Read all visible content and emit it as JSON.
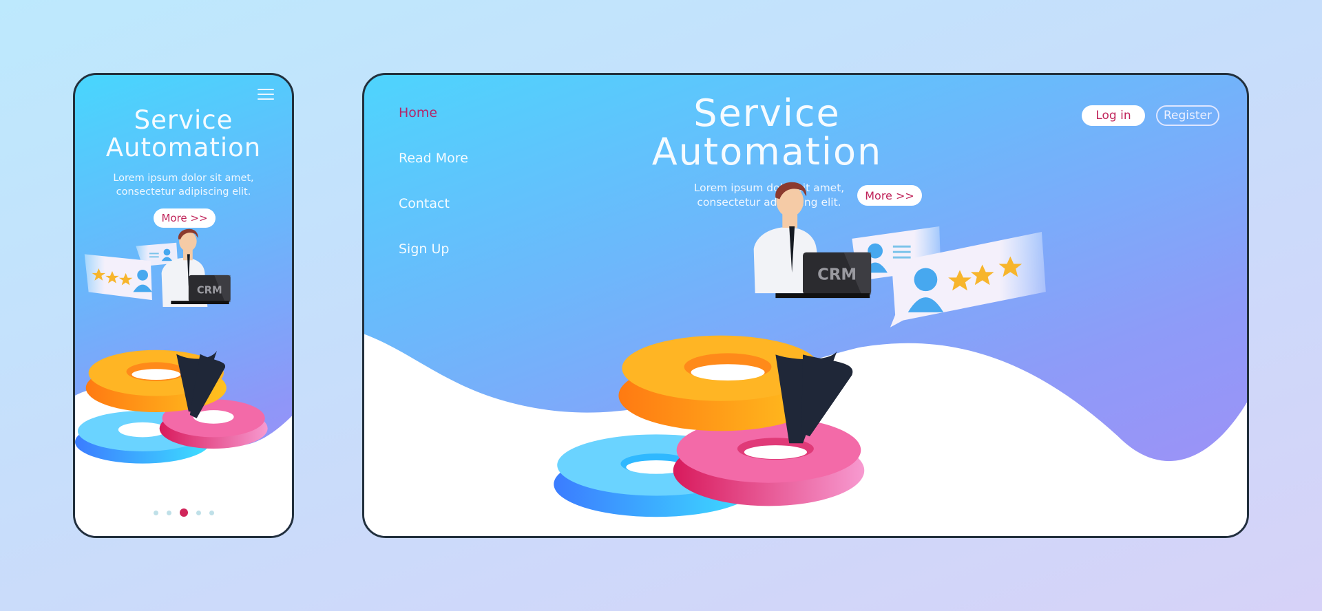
{
  "mobile": {
    "menu_icon": "hamburger-menu-icon",
    "title_line1": "Service",
    "title_line2": "Automation",
    "desc_line1": "Lorem ipsum dolor sit amet,",
    "desc_line2": "consectetur adipiscing elit.",
    "more_label": "More >>",
    "laptop_label": "CRM",
    "rating_stars": 3,
    "pagination": {
      "total": 5,
      "active_index": 2
    }
  },
  "desktop": {
    "nav": [
      {
        "label": "Home",
        "active": true
      },
      {
        "label": "Read More",
        "active": false
      },
      {
        "label": "Contact",
        "active": false
      },
      {
        "label": "Sign Up",
        "active": false
      }
    ],
    "title_line1": "Service",
    "title_line2": "Automation",
    "desc_line1": "Lorem ipsum dolor sit amet,",
    "desc_line2": "consectetur adipiscing elit.",
    "more_label": "More >>",
    "login_label": "Log in",
    "register_label": "Register",
    "laptop_label": "CRM",
    "rating_stars": 3
  },
  "colors": {
    "accent": "#c0245a",
    "nav_active": "#b2266a",
    "frame_border": "#22303d",
    "gradient_start": "#4ed4fd",
    "gradient_end": "#a28ef6",
    "gear_orange": "#ffa31a",
    "gear_blue": "#3fb6ff",
    "gear_pink": "#ea3f86",
    "star": "#f7b52c"
  }
}
